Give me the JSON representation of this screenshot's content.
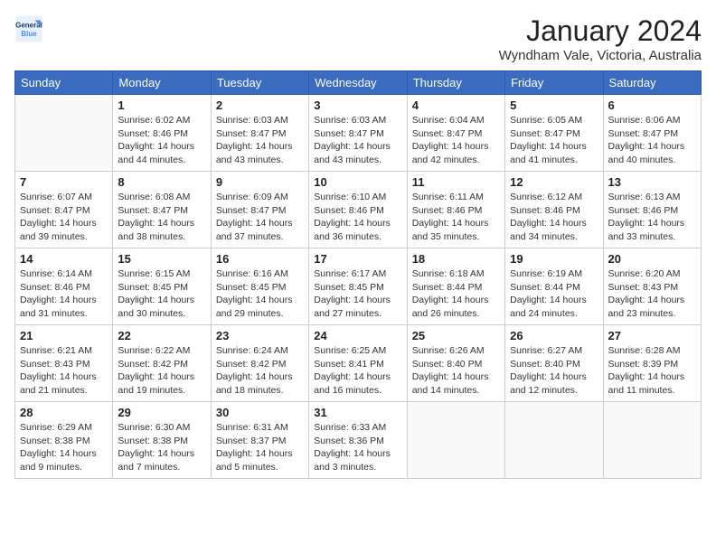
{
  "logo": {
    "line1": "General",
    "line2": "Blue"
  },
  "title": "January 2024",
  "location": "Wyndham Vale, Victoria, Australia",
  "days_of_week": [
    "Sunday",
    "Monday",
    "Tuesday",
    "Wednesday",
    "Thursday",
    "Friday",
    "Saturday"
  ],
  "weeks": [
    [
      {
        "day": "",
        "sunrise": "",
        "sunset": "",
        "daylight": ""
      },
      {
        "day": "1",
        "sunrise": "Sunrise: 6:02 AM",
        "sunset": "Sunset: 8:46 PM",
        "daylight": "Daylight: 14 hours and 44 minutes."
      },
      {
        "day": "2",
        "sunrise": "Sunrise: 6:03 AM",
        "sunset": "Sunset: 8:47 PM",
        "daylight": "Daylight: 14 hours and 43 minutes."
      },
      {
        "day": "3",
        "sunrise": "Sunrise: 6:03 AM",
        "sunset": "Sunset: 8:47 PM",
        "daylight": "Daylight: 14 hours and 43 minutes."
      },
      {
        "day": "4",
        "sunrise": "Sunrise: 6:04 AM",
        "sunset": "Sunset: 8:47 PM",
        "daylight": "Daylight: 14 hours and 42 minutes."
      },
      {
        "day": "5",
        "sunrise": "Sunrise: 6:05 AM",
        "sunset": "Sunset: 8:47 PM",
        "daylight": "Daylight: 14 hours and 41 minutes."
      },
      {
        "day": "6",
        "sunrise": "Sunrise: 6:06 AM",
        "sunset": "Sunset: 8:47 PM",
        "daylight": "Daylight: 14 hours and 40 minutes."
      }
    ],
    [
      {
        "day": "7",
        "sunrise": "Sunrise: 6:07 AM",
        "sunset": "Sunset: 8:47 PM",
        "daylight": "Daylight: 14 hours and 39 minutes."
      },
      {
        "day": "8",
        "sunrise": "Sunrise: 6:08 AM",
        "sunset": "Sunset: 8:47 PM",
        "daylight": "Daylight: 14 hours and 38 minutes."
      },
      {
        "day": "9",
        "sunrise": "Sunrise: 6:09 AM",
        "sunset": "Sunset: 8:47 PM",
        "daylight": "Daylight: 14 hours and 37 minutes."
      },
      {
        "day": "10",
        "sunrise": "Sunrise: 6:10 AM",
        "sunset": "Sunset: 8:46 PM",
        "daylight": "Daylight: 14 hours and 36 minutes."
      },
      {
        "day": "11",
        "sunrise": "Sunrise: 6:11 AM",
        "sunset": "Sunset: 8:46 PM",
        "daylight": "Daylight: 14 hours and 35 minutes."
      },
      {
        "day": "12",
        "sunrise": "Sunrise: 6:12 AM",
        "sunset": "Sunset: 8:46 PM",
        "daylight": "Daylight: 14 hours and 34 minutes."
      },
      {
        "day": "13",
        "sunrise": "Sunrise: 6:13 AM",
        "sunset": "Sunset: 8:46 PM",
        "daylight": "Daylight: 14 hours and 33 minutes."
      }
    ],
    [
      {
        "day": "14",
        "sunrise": "Sunrise: 6:14 AM",
        "sunset": "Sunset: 8:46 PM",
        "daylight": "Daylight: 14 hours and 31 minutes."
      },
      {
        "day": "15",
        "sunrise": "Sunrise: 6:15 AM",
        "sunset": "Sunset: 8:45 PM",
        "daylight": "Daylight: 14 hours and 30 minutes."
      },
      {
        "day": "16",
        "sunrise": "Sunrise: 6:16 AM",
        "sunset": "Sunset: 8:45 PM",
        "daylight": "Daylight: 14 hours and 29 minutes."
      },
      {
        "day": "17",
        "sunrise": "Sunrise: 6:17 AM",
        "sunset": "Sunset: 8:45 PM",
        "daylight": "Daylight: 14 hours and 27 minutes."
      },
      {
        "day": "18",
        "sunrise": "Sunrise: 6:18 AM",
        "sunset": "Sunset: 8:44 PM",
        "daylight": "Daylight: 14 hours and 26 minutes."
      },
      {
        "day": "19",
        "sunrise": "Sunrise: 6:19 AM",
        "sunset": "Sunset: 8:44 PM",
        "daylight": "Daylight: 14 hours and 24 minutes."
      },
      {
        "day": "20",
        "sunrise": "Sunrise: 6:20 AM",
        "sunset": "Sunset: 8:43 PM",
        "daylight": "Daylight: 14 hours and 23 minutes."
      }
    ],
    [
      {
        "day": "21",
        "sunrise": "Sunrise: 6:21 AM",
        "sunset": "Sunset: 8:43 PM",
        "daylight": "Daylight: 14 hours and 21 minutes."
      },
      {
        "day": "22",
        "sunrise": "Sunrise: 6:22 AM",
        "sunset": "Sunset: 8:42 PM",
        "daylight": "Daylight: 14 hours and 19 minutes."
      },
      {
        "day": "23",
        "sunrise": "Sunrise: 6:24 AM",
        "sunset": "Sunset: 8:42 PM",
        "daylight": "Daylight: 14 hours and 18 minutes."
      },
      {
        "day": "24",
        "sunrise": "Sunrise: 6:25 AM",
        "sunset": "Sunset: 8:41 PM",
        "daylight": "Daylight: 14 hours and 16 minutes."
      },
      {
        "day": "25",
        "sunrise": "Sunrise: 6:26 AM",
        "sunset": "Sunset: 8:40 PM",
        "daylight": "Daylight: 14 hours and 14 minutes."
      },
      {
        "day": "26",
        "sunrise": "Sunrise: 6:27 AM",
        "sunset": "Sunset: 8:40 PM",
        "daylight": "Daylight: 14 hours and 12 minutes."
      },
      {
        "day": "27",
        "sunrise": "Sunrise: 6:28 AM",
        "sunset": "Sunset: 8:39 PM",
        "daylight": "Daylight: 14 hours and 11 minutes."
      }
    ],
    [
      {
        "day": "28",
        "sunrise": "Sunrise: 6:29 AM",
        "sunset": "Sunset: 8:38 PM",
        "daylight": "Daylight: 14 hours and 9 minutes."
      },
      {
        "day": "29",
        "sunrise": "Sunrise: 6:30 AM",
        "sunset": "Sunset: 8:38 PM",
        "daylight": "Daylight: 14 hours and 7 minutes."
      },
      {
        "day": "30",
        "sunrise": "Sunrise: 6:31 AM",
        "sunset": "Sunset: 8:37 PM",
        "daylight": "Daylight: 14 hours and 5 minutes."
      },
      {
        "day": "31",
        "sunrise": "Sunrise: 6:33 AM",
        "sunset": "Sunset: 8:36 PM",
        "daylight": "Daylight: 14 hours and 3 minutes."
      },
      {
        "day": "",
        "sunrise": "",
        "sunset": "",
        "daylight": ""
      },
      {
        "day": "",
        "sunrise": "",
        "sunset": "",
        "daylight": ""
      },
      {
        "day": "",
        "sunrise": "",
        "sunset": "",
        "daylight": ""
      }
    ]
  ]
}
